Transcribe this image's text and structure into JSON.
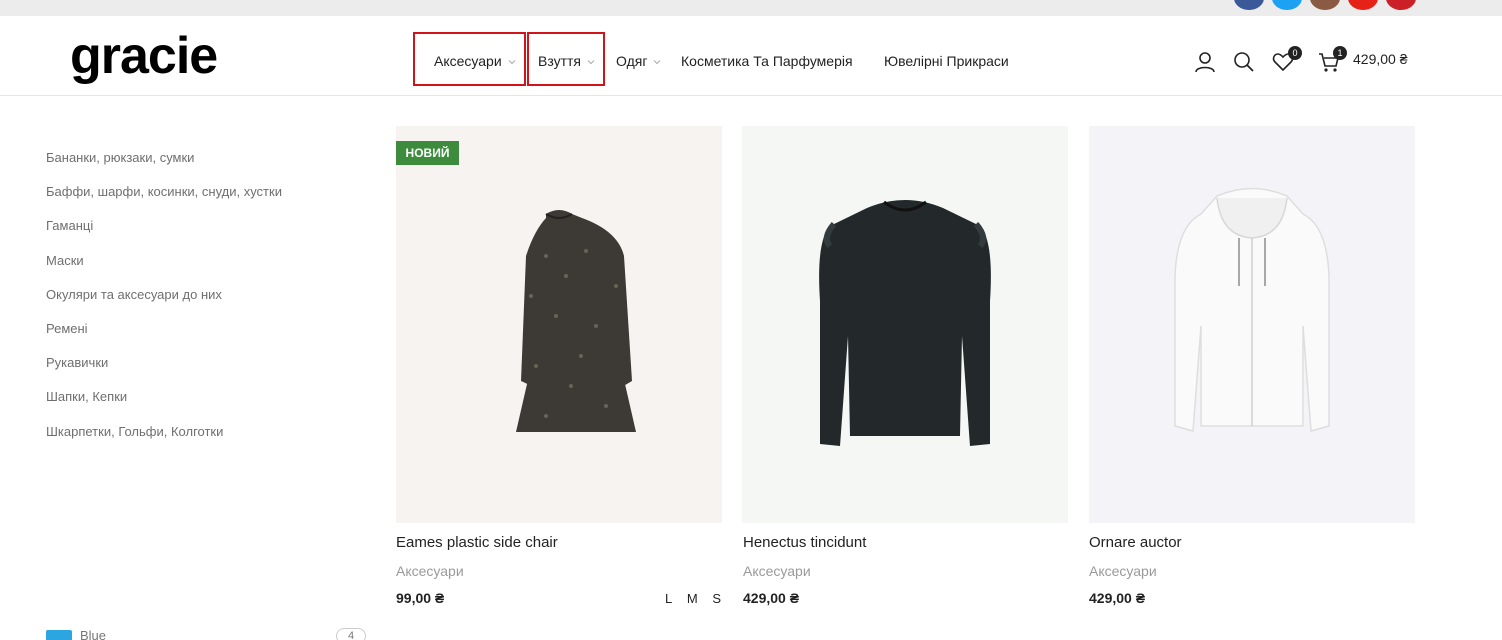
{
  "brand": {
    "logo_text": "gracie"
  },
  "nav": {
    "items": [
      {
        "label": "Аксесуари",
        "has_dropdown": true,
        "highlighted": true
      },
      {
        "label": "Взуття",
        "has_dropdown": true,
        "highlighted": true
      },
      {
        "label": "Одяг",
        "has_dropdown": true,
        "highlighted": false
      },
      {
        "label": "Косметика Та Парфумерія",
        "has_dropdown": false,
        "highlighted": false
      },
      {
        "label": "Ювелірні Прикраси",
        "has_dropdown": false,
        "highlighted": false
      }
    ]
  },
  "header_actions": {
    "account_icon": "user-icon",
    "search_icon": "search-icon",
    "wishlist_icon": "heart-icon",
    "wishlist_count": "0",
    "cart_icon": "cart-icon",
    "cart_count": "1",
    "cart_total": "429,00 ₴"
  },
  "social": [
    {
      "icon": "facebook-icon",
      "color": "#3b5998"
    },
    {
      "icon": "twitter-icon",
      "color": "#1da1f2"
    },
    {
      "icon": "instagram-icon",
      "color": "#8a5a44"
    },
    {
      "icon": "youtube-icon",
      "color": "#e62117"
    },
    {
      "icon": "pinterest-icon",
      "color": "#cb2027"
    }
  ],
  "dropdown_categories": [
    "Бананки, рюкзаки, сумки",
    "Баффи, шарфи, косинки, снуди, хустки",
    "Гаманці",
    "Маски",
    "Окуляри та аксесуари до них",
    "Ремені",
    "Рукавички",
    "Шапки, Кепки",
    "Шкарпетки, Гольфи, Колготки"
  ],
  "products": [
    {
      "title": "Eames plastic side chair",
      "category": "Аксесуари",
      "price": "99,00 ₴",
      "badge": "НОВИЙ",
      "sizes": [
        "L",
        "M",
        "S"
      ],
      "bg": "#f6f3f1",
      "image": "dress-image"
    },
    {
      "title": "Henectus tincidunt",
      "category": "Аксесуари",
      "price": "429,00 ₴",
      "bg": "#f5f7f5",
      "image": "sweater-image"
    },
    {
      "title": "Ornare auctor",
      "category": "Аксесуари",
      "price": "429,00 ₴",
      "bg": "#f4f4f8",
      "image": "hoodie-image"
    }
  ],
  "filter_peek": {
    "label": "Blue",
    "count": "4",
    "color": "#2ba6e0"
  },
  "colors": {
    "highlight": "#d0141b",
    "badge_green": "#3d8c3d"
  }
}
